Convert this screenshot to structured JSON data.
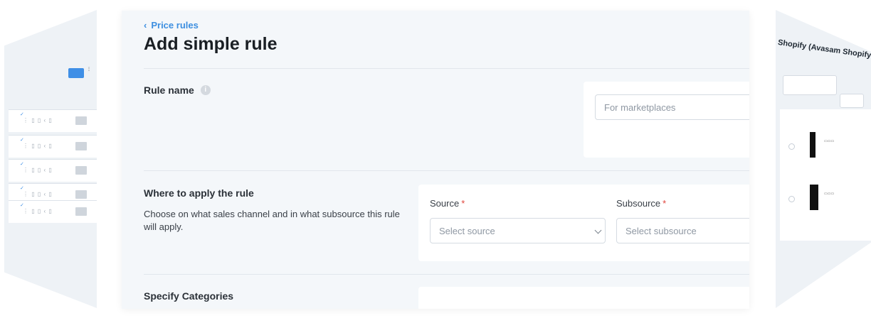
{
  "breadcrumb": {
    "label": "Price rules"
  },
  "page": {
    "title": "Add simple rule"
  },
  "rule_name": {
    "label": "Rule name",
    "placeholder": "For marketplaces"
  },
  "apply": {
    "label": "Where to apply the rule",
    "description": "Choose on what sales channel and in what subsource this rule will apply.",
    "source": {
      "label": "Source",
      "required": "*",
      "placeholder": "Select source"
    },
    "subsource": {
      "label": "Subsource",
      "required": "*",
      "placeholder": "Select subsource"
    }
  },
  "categories": {
    "label": "Specify Categories"
  },
  "right_preview": {
    "title": "Shopify (Avasam Shopify Listing Specification)"
  },
  "colors": {
    "accent": "#3d8fe0",
    "required": "#e0453c",
    "background": "#f4f7fa"
  }
}
